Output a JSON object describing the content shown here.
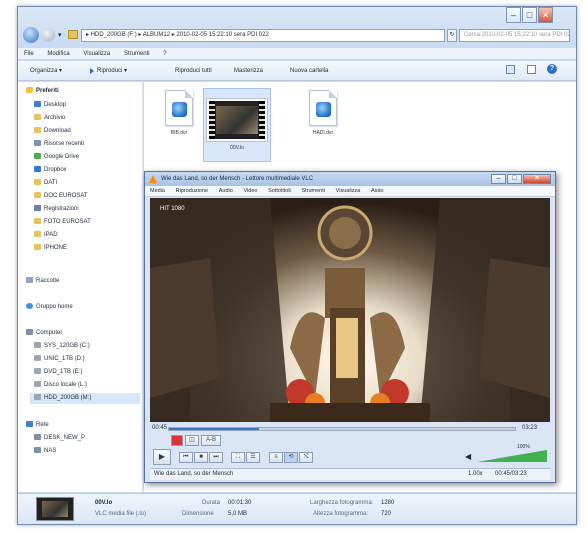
{
  "explorer": {
    "address_path": "▸ HDD_200GB (F:) ▸ ALBUM12 ▸ 2010-02-05 15:22:10 sera PDI 022",
    "search_placeholder": "Cerca 2010-02-05 15:22:10 sera PDI 022",
    "menus": [
      "File",
      "Modifica",
      "Visualizza",
      "Strumenti",
      "?"
    ],
    "toolbar": [
      "Organizza ▾",
      "Riproduci ▾",
      "Riproduci tutti",
      "Masterizza",
      "Nuova cartella"
    ],
    "nav": {
      "favorites_header": "Preferiti",
      "favorites": [
        "Desktop",
        "Archivio",
        "Download",
        "Risorse recenti",
        "Google Drive",
        "Dropbox",
        "DATI",
        "DOC EUROSAT",
        "Registrazioni",
        "FOTO EUROSAT",
        "IPAD",
        "IPHONE"
      ],
      "libraries": "Raccolte",
      "homegroup": "Gruppo home",
      "computer": "Computer",
      "drives": [
        "SYS_120GB (C:)",
        "UNIC_1TB (D:)",
        "DVD_1TB (E:)",
        "Disco locale (L:)",
        "HDD_200GB (M:)"
      ],
      "network_header": "Rete",
      "network": [
        "DESK_NEW_P",
        "NAS"
      ]
    },
    "files": [
      {
        "name": "BIB.dvr",
        "kind": "media"
      },
      {
        "name": "00V.lo",
        "kind": "video"
      },
      {
        "name": "HADI.dvr",
        "kind": "media"
      }
    ],
    "status": {
      "filename": "00V.lo",
      "filetype": "VLC media file (.lo)",
      "duration_label": "Durata",
      "duration": "00:01:30",
      "dimensions_label": "Dimensione",
      "dimensions": "5,0 MB",
      "framewidth_label": "Larghezza fotogramma:",
      "framewidth": "1280",
      "frameheight_label": "Altezza fotogramma:",
      "frameheight": "720"
    }
  },
  "vlc": {
    "title": "Wie das Land, so der Mensch - Lettore multimediale VLC",
    "menus": [
      "Media",
      "Riproduzione",
      "Audio",
      "Video",
      "Sottotitoli",
      "Strumenti",
      "Visualizza",
      "Aiuto"
    ],
    "video_caption": "HIT 1080",
    "time_elapsed": "00:45",
    "time_total": "03:23",
    "progress": 0.26,
    "volume": "100%",
    "status_title": "Wie das Land, so der Mensch",
    "speed": "1.00x",
    "status_time": "00:45/03:23"
  }
}
